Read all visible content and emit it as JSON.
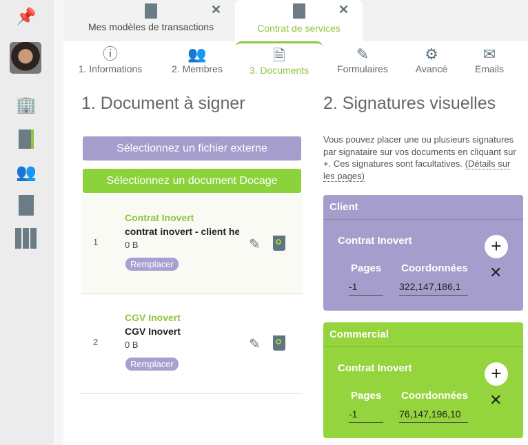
{
  "sidebar": {
    "items": [
      "pin-icon",
      "avatar",
      "building-icon",
      "document-edit-icon",
      "users-icon",
      "document-icon",
      "binders-icon"
    ]
  },
  "tabs": [
    {
      "label": "Mes modèles de transactions",
      "active": false
    },
    {
      "label": "Contrat de services",
      "active": true
    }
  ],
  "steps": [
    {
      "label": "1. Informations"
    },
    {
      "label": "2. Membres"
    },
    {
      "label": "3. Documents",
      "active": true
    },
    {
      "label": "Formulaires"
    },
    {
      "label": "Avancé"
    },
    {
      "label": "Emails"
    }
  ],
  "left": {
    "title": "1. Document à signer",
    "btn_external": "Sélectionnez un fichier externe",
    "btn_docage": "Sélectionnez un document Docage",
    "documents": [
      {
        "num": "1",
        "title": "Contrat Inovert",
        "name": "contrat inovert - client heu",
        "size": "0 B",
        "replace": "Remplacer"
      },
      {
        "num": "2",
        "title": "CGV Inovert",
        "name": "CGV Inovert",
        "size": "0 B",
        "replace": "Remplacer"
      }
    ]
  },
  "right": {
    "title": "2. Signatures visuelles",
    "description": "Vous pouvez placer une ou plusieurs signatures par signataire sur vos documents en cliquant sur +. Ces signatures sont facultatives. ",
    "details_link": "(Détails sur les pages)",
    "signers": [
      {
        "name": "Client",
        "color": "#a59dcb",
        "document": "Contrat Inovert",
        "pages_label": "Pages",
        "coords_label": "Coordonnées",
        "pages": "-1",
        "coords": "322,147,186,1"
      },
      {
        "name": "Commercial",
        "color": "#94d43c",
        "document": "Contrat Inovert",
        "pages_label": "Pages",
        "coords_label": "Coordonnées",
        "pages": "-1",
        "coords": "76,147,196,10"
      }
    ]
  },
  "colors": {
    "accent_green": "#8cc63f",
    "purple": "#a59dcb"
  }
}
